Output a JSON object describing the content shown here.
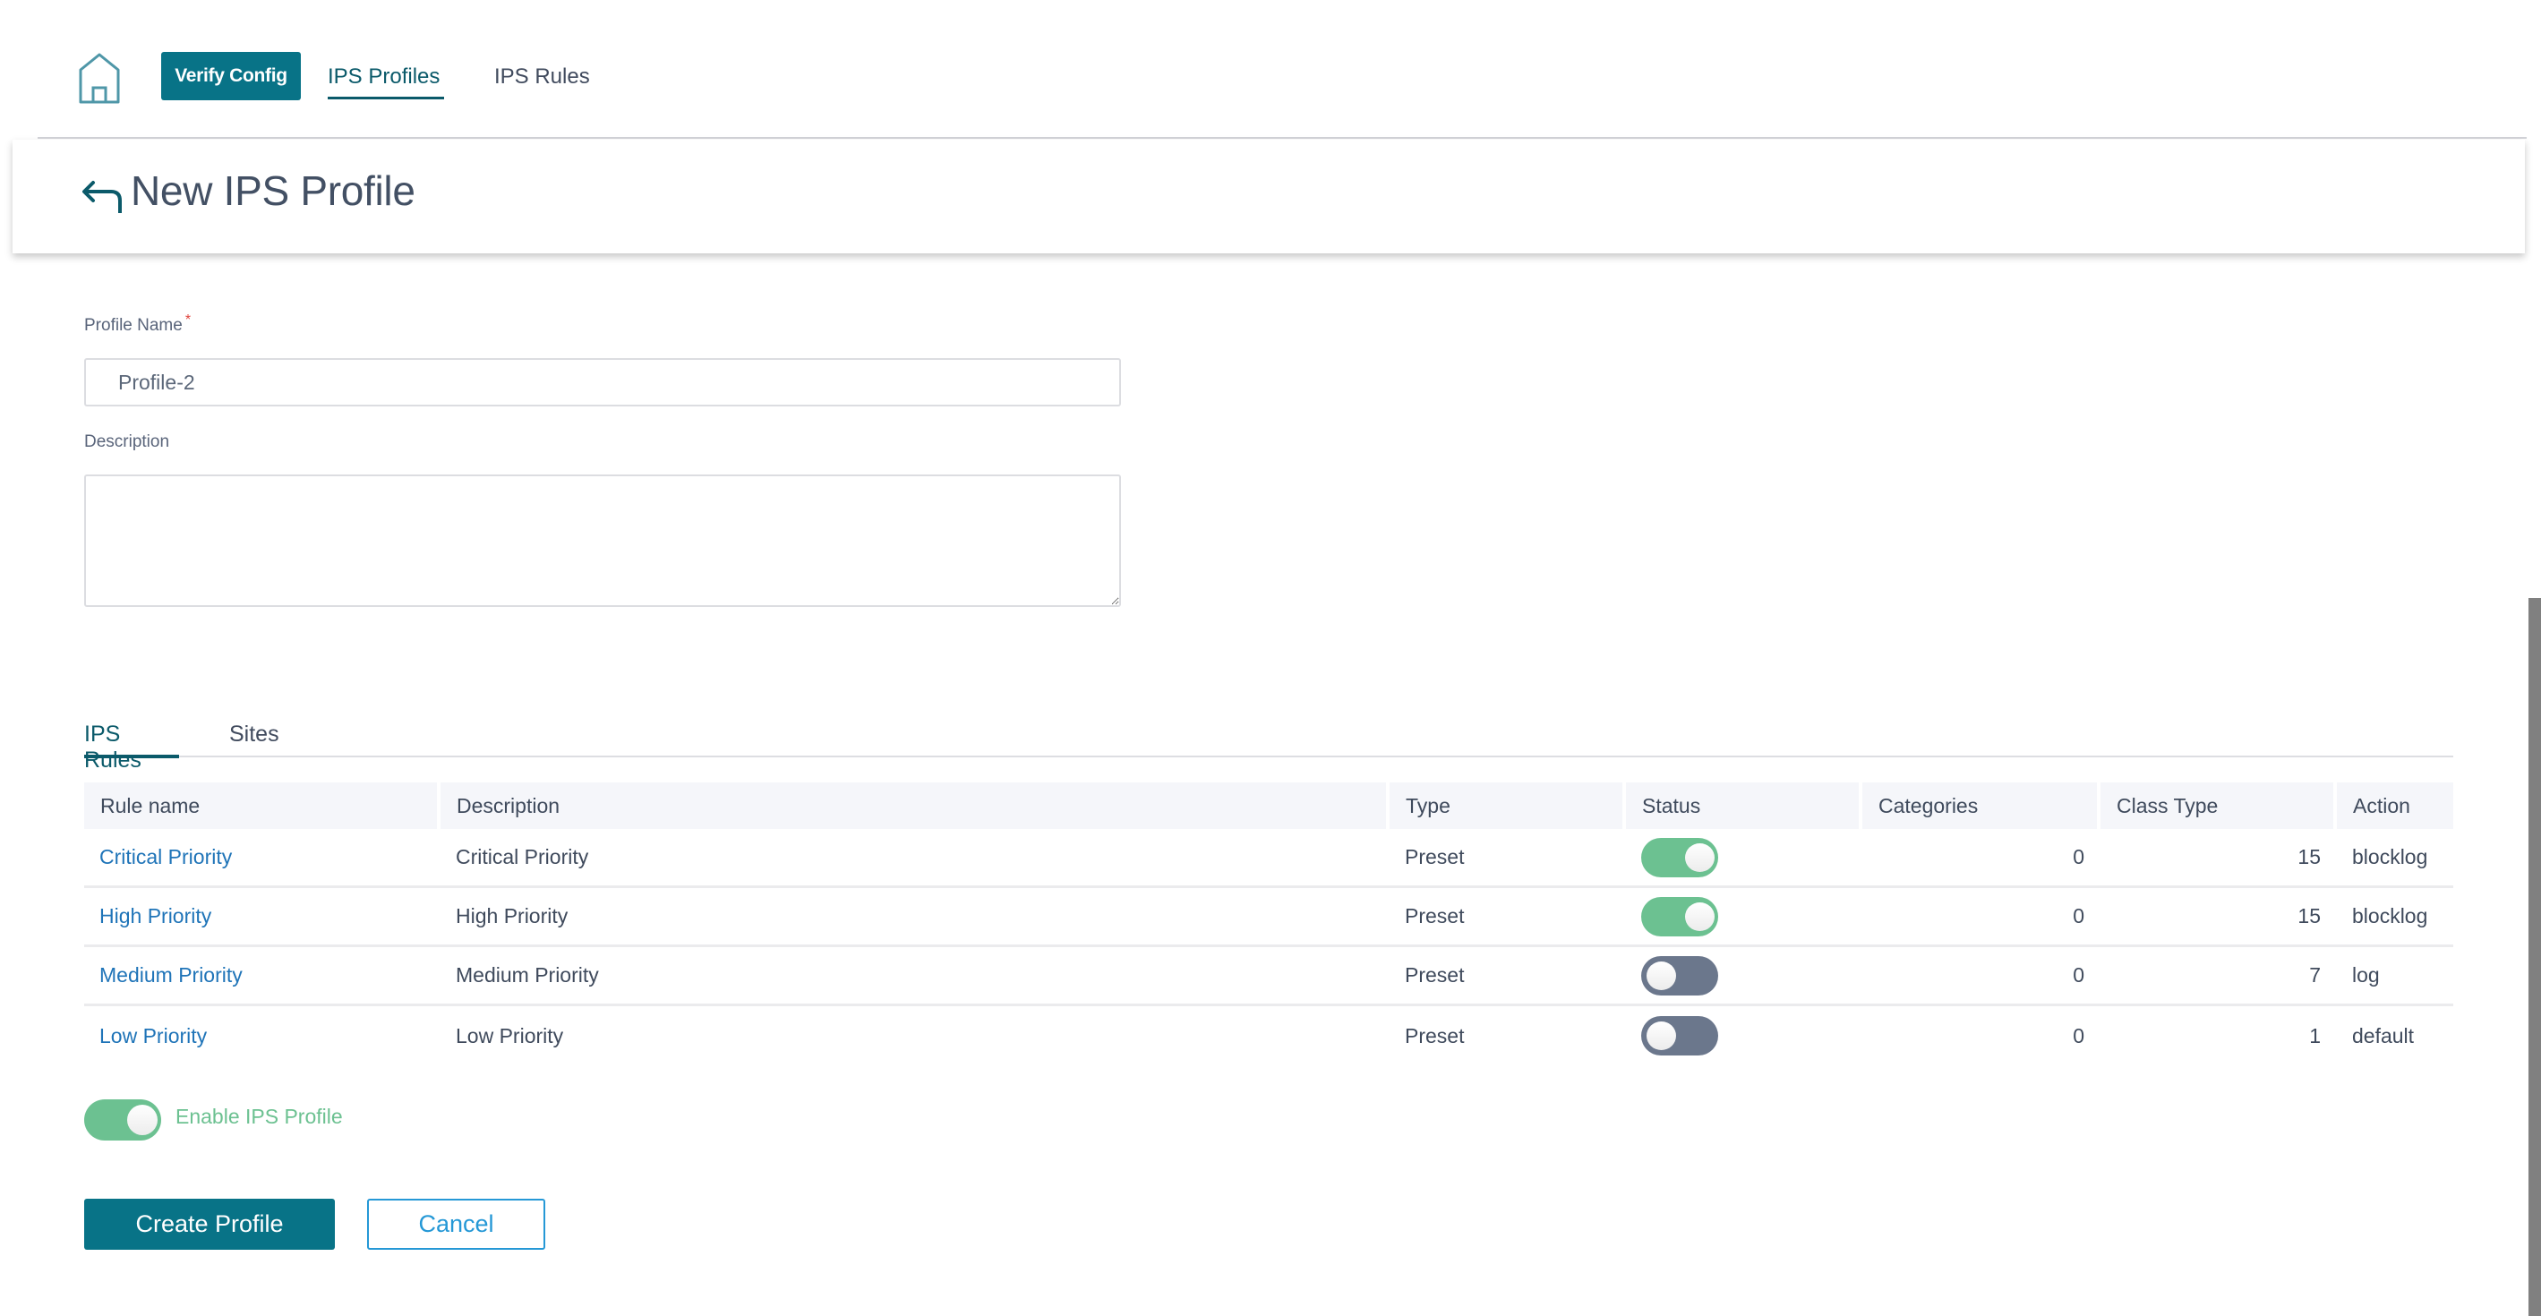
{
  "nav": {
    "home_icon": "home-icon",
    "verify_button": "Verify Config",
    "tabs": [
      {
        "label": "IPS Profiles",
        "active": true
      },
      {
        "label": "IPS Rules",
        "active": false
      }
    ]
  },
  "header": {
    "back_icon": "back-arrow-icon",
    "title": "New IPS Profile"
  },
  "form": {
    "profile_name": {
      "label": "Profile Name",
      "required_mark": "*",
      "value": "Profile-2"
    },
    "description": {
      "label": "Description",
      "value": ""
    }
  },
  "subtabs": [
    {
      "label": "IPS Rules",
      "active": true
    },
    {
      "label": "Sites",
      "active": false
    }
  ],
  "table": {
    "columns": [
      "Rule name",
      "Description",
      "Type",
      "Status",
      "Categories",
      "Class Type",
      "Action"
    ],
    "rows": [
      {
        "rule_name": "Critical Priority",
        "description": "Critical Priority",
        "type": "Preset",
        "status": "on",
        "categories": "0",
        "class_type": "15",
        "action": "blocklog"
      },
      {
        "rule_name": "High Priority",
        "description": "High Priority",
        "type": "Preset",
        "status": "on",
        "categories": "0",
        "class_type": "15",
        "action": "blocklog"
      },
      {
        "rule_name": "Medium Priority",
        "description": "Medium Priority",
        "type": "Preset",
        "status": "off",
        "categories": "0",
        "class_type": "7",
        "action": "log"
      },
      {
        "rule_name": "Low Priority",
        "description": "Low Priority",
        "type": "Preset",
        "status": "off",
        "categories": "0",
        "class_type": "1",
        "action": "default"
      }
    ]
  },
  "enable_profile": {
    "label": "Enable IPS Profile",
    "state": "on"
  },
  "actions": {
    "create": "Create Profile",
    "cancel": "Cancel"
  },
  "colors": {
    "primary": "#087387",
    "toggle_on": "#6cc191",
    "toggle_off": "#6b778c",
    "link": "#1f74b8",
    "cancel_outline": "#2598d6",
    "required": "#e0463f"
  }
}
